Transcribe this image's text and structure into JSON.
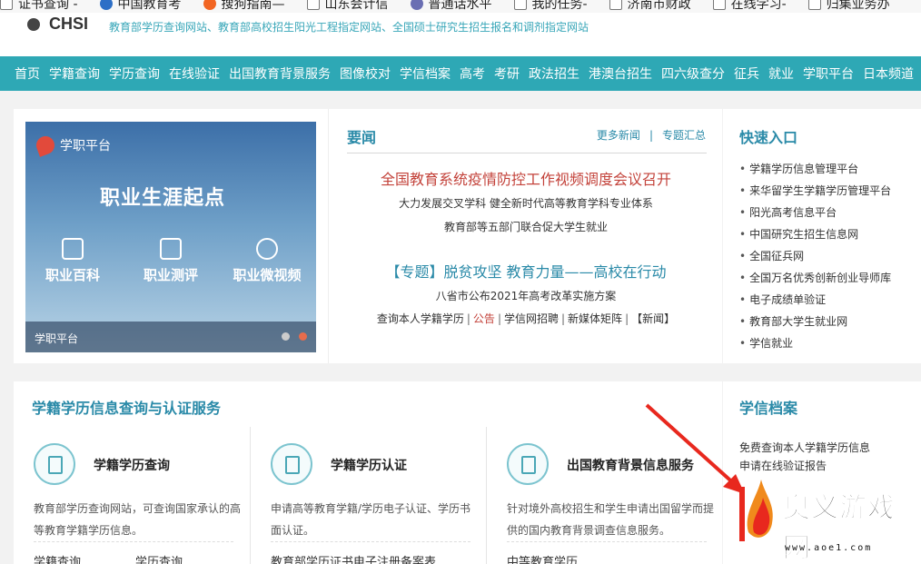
{
  "bookmarks": [
    {
      "label": "证书查询 -",
      "icon": "document-icon"
    },
    {
      "label": "中国教育考",
      "icon": "globe-icon"
    },
    {
      "label": "搜狗指南—",
      "icon": "sogou-icon"
    },
    {
      "label": "山东会计信",
      "icon": "document-icon"
    },
    {
      "label": "普通话水平",
      "icon": "x-logo-icon"
    },
    {
      "label": "我的任务-",
      "icon": "document-icon"
    },
    {
      "label": "济南市财政",
      "icon": "document-icon"
    },
    {
      "label": "在线学习-",
      "icon": "document-icon"
    },
    {
      "label": "归集业务办",
      "icon": "document-icon"
    }
  ],
  "header": {
    "logo": "CHSI",
    "tagline": "教育部学历查询网站、教育部高校招生阳光工程指定网站、全国硕士研究生招生报名和调剂指定网站"
  },
  "nav": [
    "首页",
    "学籍查询",
    "学历查询",
    "在线验证",
    "出国教育背景服务",
    "图像校对",
    "学信档案",
    "高考",
    "考研",
    "政法招生",
    "港澳台招生",
    "四六级查分",
    "征兵",
    "就业",
    "学职平台",
    "日本频道"
  ],
  "banner": {
    "brand": "学职平台",
    "slogan": "职业生涯起点",
    "features": [
      "职业百科",
      "职业测评",
      "职业微视频"
    ],
    "caption": "学职平台"
  },
  "news": {
    "title": "要闻",
    "more": "更多新闻",
    "topics": "专题汇总",
    "separator": "|",
    "headline1": "全国教育系统疫情防控工作视频调度会议召开",
    "sub1a": "大力发展交叉学科 健全新时代高等教育学科专业体系",
    "sub1b": "教育部等五部门联合促大学生就业",
    "headline2": "【专题】脱贫攻坚 教育力量——高校在行动",
    "sub2a": "八省市公布2021年高考改革实施方案",
    "links": {
      "l1": "查询本人学籍学历",
      "l2": "公告",
      "l3": "学信网招聘",
      "l4": "新媒体矩阵",
      "l5": "【新闻】",
      "pipe": "|"
    }
  },
  "quick": {
    "title": "快速入口",
    "items": [
      "学籍学历信息管理平台",
      "来华留学生学籍学历管理平台",
      "阳光高考信息平台",
      "中国研究生招生信息网",
      "全国征兵网",
      "全国万名优秀创新创业导师库",
      "电子成绩单验证",
      "教育部大学生就业网",
      "学信就业"
    ]
  },
  "service": {
    "title": "学籍学历信息查询与认证服务",
    "cols": [
      {
        "title": "学籍学历查询",
        "desc": "教育部学历查询网站，可查询国家承认的高等教育学籍学历信息。",
        "bottom1": "学籍查询",
        "bottom2": "学历查询"
      },
      {
        "title": "学籍学历认证",
        "desc": "申请高等教育学籍/学历电子认证、学历书面认证。",
        "bottom1": "教育部学历证书电子注册备案表",
        "bottom2": ""
      },
      {
        "title": "出国教育背景信息服务",
        "desc": "针对境外高校招生和学生申请出国留学而提供的国内教育背景调查信息服务。",
        "bottom1": "中等教育学历",
        "bottom2": ""
      }
    ]
  },
  "archive": {
    "title": "学信档案",
    "items": [
      "免费查询本人学籍学历信息",
      "申请在线验证报告"
    ]
  },
  "watermark": {
    "text": "奥义游戏网",
    "url": "www.aoe1.com"
  },
  "colors": {
    "nav": "#2ea8b5",
    "accent": "#2a8aa8",
    "red": "#c3423a",
    "arrow": "#e8281e"
  }
}
